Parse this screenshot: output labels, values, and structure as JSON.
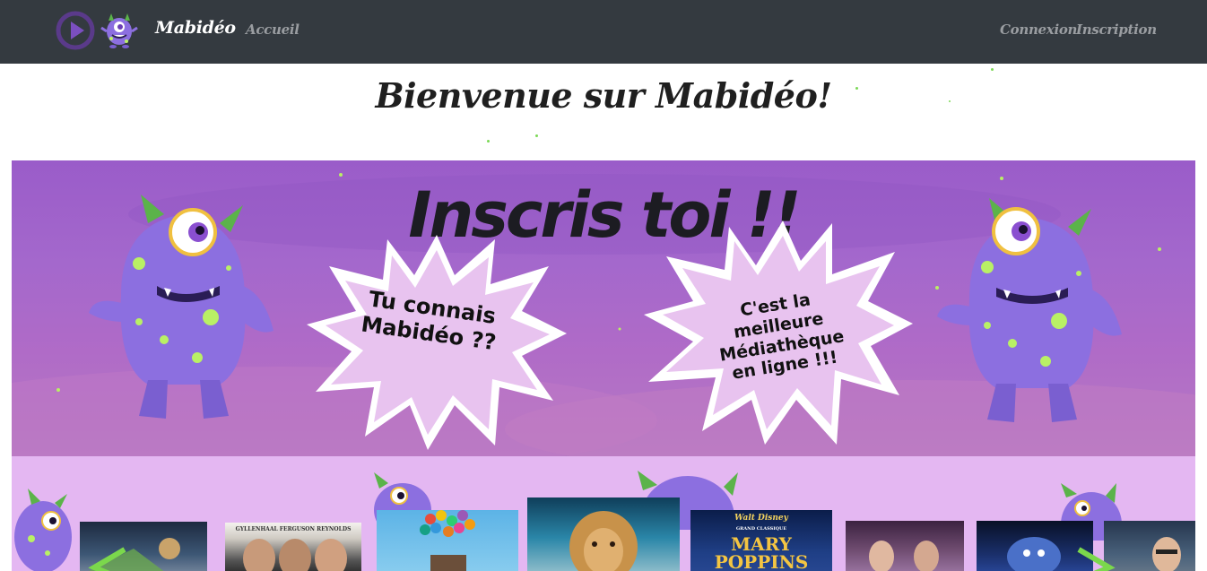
{
  "navbar": {
    "brand": "Mabidéo",
    "links": {
      "home": "Accueil",
      "login": "Connexion",
      "register": "Inscription"
    },
    "logo_play_icon": "play-circle-icon",
    "logo_monster_icon": "purple-monster-icon"
  },
  "page": {
    "title": "Bienvenue sur Mabidéo!"
  },
  "banner": {
    "title": "Inscris toi !!",
    "bubble_left": "Tu connais Mabidéo ??",
    "bubble_right": "C'est la meilleure Médiathèque en ligne !!!"
  },
  "posters": [
    {
      "name": "poster-1"
    },
    {
      "name": "poster-2",
      "credit": "GYLLENHAAL   FERGUSON   REYNOLDS"
    },
    {
      "name": "poster-3"
    },
    {
      "name": "poster-4"
    },
    {
      "name": "poster-5",
      "brand": "Walt Disney",
      "subtitle": "GRAND CLASSIQUE",
      "title": "MARY POPPINS"
    },
    {
      "name": "poster-6"
    },
    {
      "name": "poster-7"
    },
    {
      "name": "poster-8"
    }
  ],
  "colors": {
    "navbar": "#343a40",
    "brand_text": "#ffffff",
    "nav_link": "#9a9da1",
    "banner_purple": "#a468cc",
    "strip_lilac": "#e4b7f2",
    "monster_purple": "#8c6fe0",
    "monster_spots": "#b9f065"
  }
}
